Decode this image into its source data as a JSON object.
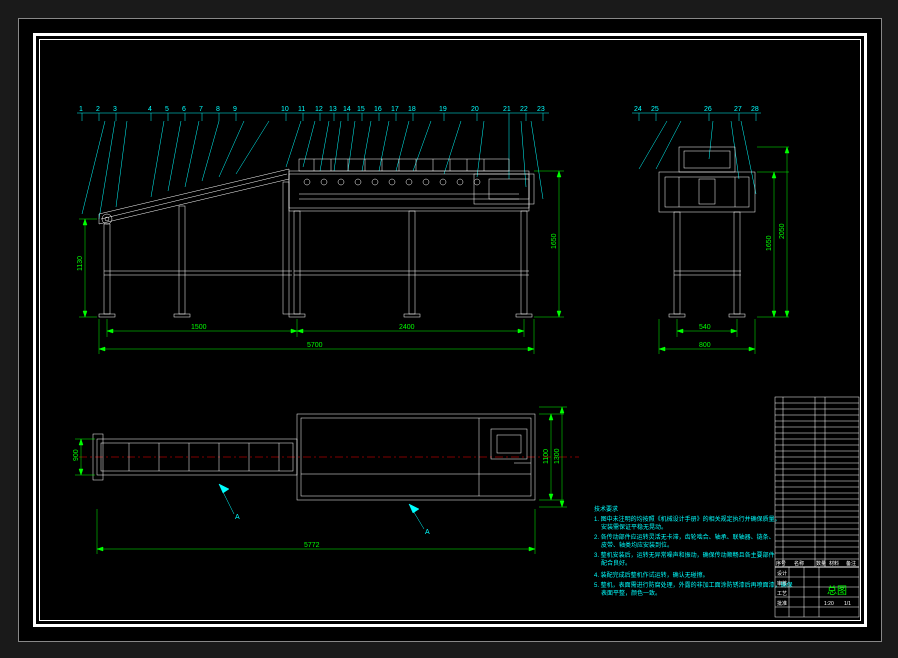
{
  "drawing": {
    "title": "总图",
    "refs_top": [
      "1",
      "2",
      "3",
      "4",
      "5",
      "6",
      "7",
      "8",
      "9",
      "10",
      "11",
      "12",
      "13",
      "14",
      "15",
      "16",
      "17",
      "18",
      "19",
      "20",
      "21",
      "22",
      "23"
    ],
    "refs_right": [
      "24",
      "25",
      "26",
      "27",
      "28"
    ],
    "dims": {
      "side_height1": "1130",
      "side_height2": "1650",
      "side_span1": "1500",
      "side_span2": "2400",
      "side_total": "5700",
      "end_width": "540",
      "end_total": "800",
      "end_height1": "1650",
      "end_height2": "2050",
      "plan_w1": "900",
      "plan_w2": "1100",
      "plan_w3": "1300",
      "plan_len": "5772"
    },
    "section_marks": [
      "A",
      "A"
    ],
    "notes": {
      "heading": "技术要求",
      "n1": "1. 图中未注明的均按照《机械设计手册》的相关规定执行并确保质量。",
      "n1b": "安装需保证平稳无晃动。",
      "n2": "2. 各传动部件应运转灵活无卡滞，齿轮啮合、轴承、联轴器、链条、",
      "n2b": "皮带、轴类均应安装到位。",
      "n3": "3. 整机安装后，运转无异常噪声和振动，确保传动顺畅且各主要部件",
      "n3b": "配合良好。",
      "n4": "4. 装配完成后整机作试运转，确认无碰擦。",
      "n5": "5. 整机，表面需进行防腐处理，外露的非加工面涂防锈漆后再喷面漆，确保",
      "n5b": "表面平整，颜色一致。"
    }
  },
  "titleblock": {
    "col_headers": [
      "序号",
      "名称",
      "数量",
      "材料",
      "备注"
    ],
    "sign_rows": [
      "设计",
      "审核",
      "工艺",
      "批准"
    ],
    "scale": "1:20",
    "sheet": "1/1"
  }
}
